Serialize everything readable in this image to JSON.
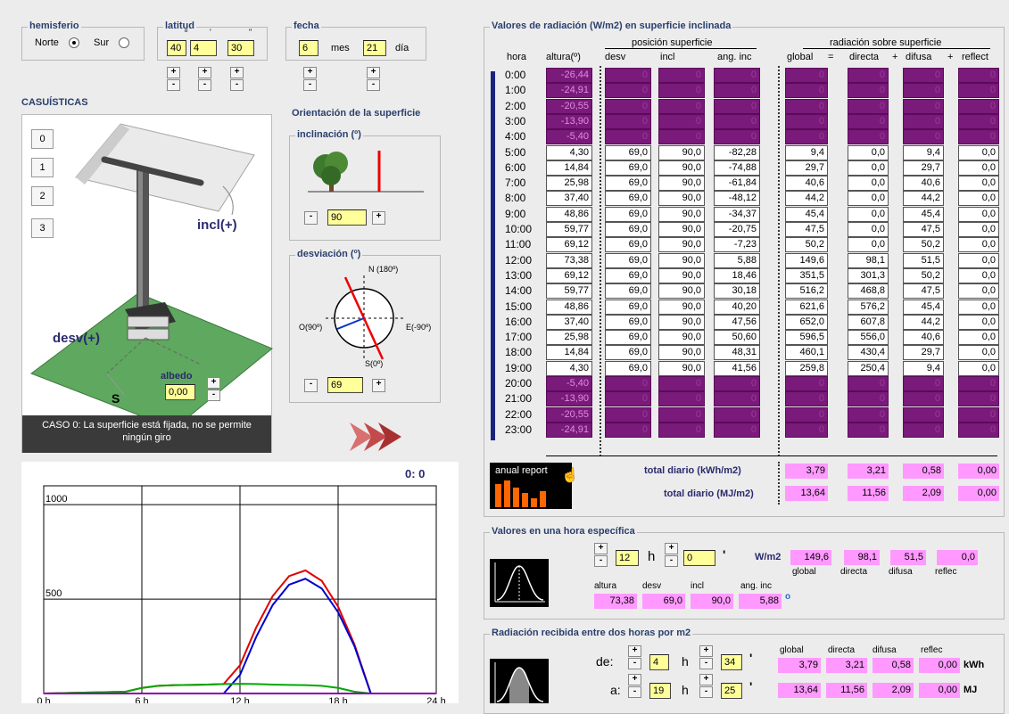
{
  "hemisferio": {
    "title": "hemisferio",
    "norte": "Norte",
    "sur": "Sur",
    "selected": "Norte"
  },
  "latitud": {
    "title": "latitud",
    "deg": "40",
    "min": "4",
    "sec": "30",
    "deg_sym": "º",
    "min_sym": "'",
    "sec_sym": "\""
  },
  "fecha": {
    "title": "fecha",
    "mes_val": "6",
    "mes_lbl": "mes",
    "dia_val": "21",
    "dia_lbl": "día"
  },
  "casuisticas": {
    "title": "CASUÍSTICAS",
    "buttons": [
      "0",
      "1",
      "2",
      "3"
    ],
    "incl_label": "incl(+)",
    "desv_label": "desv(+)",
    "s_label": "S",
    "albedo_label": "albedo",
    "albedo_val": "0,00",
    "caso_text": "CASO 0:  La superficie está fijada, no se permite ningún giro"
  },
  "orientacion": {
    "title": "Orientación de la superficie",
    "inclinacion_title": "inclinación (º)",
    "incl_val": "90",
    "desviacion_title": "desviación (º)",
    "desv_val": "69",
    "n": "N (180º)",
    "s": "S(0º)",
    "o": "O(90º)",
    "e": "E(-90º)"
  },
  "tabla": {
    "title": "Valores de radiación (W/m2) en superficie inclinada",
    "h_hora": "hora",
    "h_altura": "altura(º)",
    "h_pos": "posición superficie",
    "h_desv": "desv",
    "h_incl": "incl",
    "h_anginc": "ang. inc",
    "h_rad": "radiación sobre superficie",
    "h_global": "global",
    "h_eq": "=",
    "h_directa": "directa",
    "h_plus1": "+",
    "h_difusa": "difusa",
    "h_plus2": "+",
    "h_reflect": "reflect",
    "rows": [
      {
        "h": "0:00",
        "a": "-26,44",
        "d": "0",
        "i": "0",
        "g": "0",
        "gl": "0",
        "di": "0",
        "df": "0",
        "rf": "0",
        "p": true
      },
      {
        "h": "1:00",
        "a": "-24,91",
        "d": "0",
        "i": "0",
        "g": "0",
        "gl": "0",
        "di": "0",
        "df": "0",
        "rf": "0",
        "p": true
      },
      {
        "h": "2:00",
        "a": "-20,55",
        "d": "0",
        "i": "0",
        "g": "0",
        "gl": "0",
        "di": "0",
        "df": "0",
        "rf": "0",
        "p": true
      },
      {
        "h": "3:00",
        "a": "-13,90",
        "d": "0",
        "i": "0",
        "g": "0",
        "gl": "0",
        "di": "0",
        "df": "0",
        "rf": "0",
        "p": true
      },
      {
        "h": "4:00",
        "a": "-5,40",
        "d": "0",
        "i": "0",
        "g": "0",
        "gl": "0",
        "di": "0",
        "df": "0",
        "rf": "0",
        "p": true
      },
      {
        "h": "5:00",
        "a": "4,30",
        "d": "69,0",
        "i": "90,0",
        "g": "-82,28",
        "gl": "9,4",
        "di": "0,0",
        "df": "9,4",
        "rf": "0,0",
        "p": false
      },
      {
        "h": "6:00",
        "a": "14,84",
        "d": "69,0",
        "i": "90,0",
        "g": "-74,88",
        "gl": "29,7",
        "di": "0,0",
        "df": "29,7",
        "rf": "0,0",
        "p": false
      },
      {
        "h": "7:00",
        "a": "25,98",
        "d": "69,0",
        "i": "90,0",
        "g": "-61,84",
        "gl": "40,6",
        "di": "0,0",
        "df": "40,6",
        "rf": "0,0",
        "p": false
      },
      {
        "h": "8:00",
        "a": "37,40",
        "d": "69,0",
        "i": "90,0",
        "g": "-48,12",
        "gl": "44,2",
        "di": "0,0",
        "df": "44,2",
        "rf": "0,0",
        "p": false
      },
      {
        "h": "9:00",
        "a": "48,86",
        "d": "69,0",
        "i": "90,0",
        "g": "-34,37",
        "gl": "45,4",
        "di": "0,0",
        "df": "45,4",
        "rf": "0,0",
        "p": false
      },
      {
        "h": "10:00",
        "a": "59,77",
        "d": "69,0",
        "i": "90,0",
        "g": "-20,75",
        "gl": "47,5",
        "di": "0,0",
        "df": "47,5",
        "rf": "0,0",
        "p": false
      },
      {
        "h": "11:00",
        "a": "69,12",
        "d": "69,0",
        "i": "90,0",
        "g": "-7,23",
        "gl": "50,2",
        "di": "0,0",
        "df": "50,2",
        "rf": "0,0",
        "p": false
      },
      {
        "h": "12:00",
        "a": "73,38",
        "d": "69,0",
        "i": "90,0",
        "g": "5,88",
        "gl": "149,6",
        "di": "98,1",
        "df": "51,5",
        "rf": "0,0",
        "p": false
      },
      {
        "h": "13:00",
        "a": "69,12",
        "d": "69,0",
        "i": "90,0",
        "g": "18,46",
        "gl": "351,5",
        "di": "301,3",
        "df": "50,2",
        "rf": "0,0",
        "p": false
      },
      {
        "h": "14:00",
        "a": "59,77",
        "d": "69,0",
        "i": "90,0",
        "g": "30,18",
        "gl": "516,2",
        "di": "468,8",
        "df": "47,5",
        "rf": "0,0",
        "p": false
      },
      {
        "h": "15:00",
        "a": "48,86",
        "d": "69,0",
        "i": "90,0",
        "g": "40,20",
        "gl": "621,6",
        "di": "576,2",
        "df": "45,4",
        "rf": "0,0",
        "p": false
      },
      {
        "h": "16:00",
        "a": "37,40",
        "d": "69,0",
        "i": "90,0",
        "g": "47,56",
        "gl": "652,0",
        "di": "607,8",
        "df": "44,2",
        "rf": "0,0",
        "p": false
      },
      {
        "h": "17:00",
        "a": "25,98",
        "d": "69,0",
        "i": "90,0",
        "g": "50,60",
        "gl": "596,5",
        "di": "556,0",
        "df": "40,6",
        "rf": "0,0",
        "p": false
      },
      {
        "h": "18:00",
        "a": "14,84",
        "d": "69,0",
        "i": "90,0",
        "g": "48,31",
        "gl": "460,1",
        "di": "430,4",
        "df": "29,7",
        "rf": "0,0",
        "p": false
      },
      {
        "h": "19:00",
        "a": "4,30",
        "d": "69,0",
        "i": "90,0",
        "g": "41,56",
        "gl": "259,8",
        "di": "250,4",
        "df": "9,4",
        "rf": "0,0",
        "p": false
      },
      {
        "h": "20:00",
        "a": "-5,40",
        "d": "0",
        "i": "0",
        "g": "0",
        "gl": "0",
        "di": "0",
        "df": "0",
        "rf": "0",
        "p": true
      },
      {
        "h": "21:00",
        "a": "-13,90",
        "d": "0",
        "i": "0",
        "g": "0",
        "gl": "0",
        "di": "0",
        "df": "0",
        "rf": "0",
        "p": true
      },
      {
        "h": "22:00",
        "a": "-20,55",
        "d": "0",
        "i": "0",
        "g": "0",
        "gl": "0",
        "di": "0",
        "df": "0",
        "rf": "0",
        "p": true
      },
      {
        "h": "23:00",
        "a": "-24,91",
        "d": "0",
        "i": "0",
        "g": "0",
        "gl": "0",
        "di": "0",
        "df": "0",
        "rf": "0",
        "p": true
      }
    ],
    "anual_report": "anual report",
    "total_kwh_label": "total diario (kWh/m2)",
    "total_kwh": [
      "3,79",
      "3,21",
      "0,58",
      "0,00"
    ],
    "total_mj_label": "total diario (MJ/m2)",
    "total_mj": [
      "13,64",
      "11,56",
      "2,09",
      "0,00"
    ]
  },
  "hora_especifica": {
    "title": "Valores en una hora específica",
    "h_val": "12",
    "h_lbl": "h",
    "m_val": "0",
    "m_sym": "'",
    "wm2": "W/m2",
    "vals": [
      "149,6",
      "98,1",
      "51,5",
      "0,0"
    ],
    "val_lbls": [
      "global",
      "directa",
      "difusa",
      "reflec"
    ],
    "sub_lbls": [
      "altura",
      "desv",
      "incl",
      "ang. inc"
    ],
    "sub_vals": [
      "73,38",
      "69,0",
      "90,0",
      "5,88"
    ],
    "deg": "o"
  },
  "entre_horas": {
    "title": "Radiación recibida entre dos horas por m2",
    "de": "de:",
    "de_h": "4",
    "de_m": "34",
    "a": "a:",
    "a_h": "19",
    "a_m": "25",
    "h_lbl": "h",
    "m_sym": "'",
    "lbls": [
      "global",
      "directa",
      "difusa",
      "reflec"
    ],
    "kwh": [
      "3,79",
      "3,21",
      "0,58",
      "0,00"
    ],
    "kwh_unit": "kWh",
    "mj": [
      "13,64",
      "11,56",
      "2,09",
      "0,00"
    ],
    "mj_unit": "MJ"
  },
  "chart_data": {
    "type": "line",
    "title": "",
    "time_readout": "0:  0",
    "ylim": [
      0,
      1100
    ],
    "xlim": [
      0,
      24
    ],
    "yticks": [
      "1000",
      "500"
    ],
    "xticks": [
      "0 h",
      "6 h",
      "12 h",
      "18 h",
      "24 h"
    ],
    "series": [
      {
        "color": "#e00000",
        "x": [
          0,
          5,
          6,
          7,
          8,
          9,
          10,
          11,
          12,
          13,
          14,
          15,
          16,
          17,
          18,
          19,
          20,
          24
        ],
        "y": [
          0,
          9.4,
          29.7,
          40.6,
          44.2,
          45.4,
          47.5,
          50.2,
          149.6,
          351.5,
          516.2,
          621.6,
          652.0,
          596.5,
          460.1,
          259.8,
          0,
          0
        ]
      },
      {
        "color": "#0000cc",
        "x": [
          0,
          11,
          12,
          13,
          14,
          15,
          16,
          17,
          18,
          19,
          20,
          24
        ],
        "y": [
          0,
          0,
          98.1,
          301.3,
          468.8,
          576.2,
          607.8,
          556.0,
          430.4,
          250.4,
          0,
          0
        ]
      },
      {
        "color": "#00aa00",
        "x": [
          0,
          5,
          6,
          7,
          8,
          9,
          10,
          11,
          12,
          13,
          14,
          15,
          16,
          17,
          18,
          19,
          20,
          24
        ],
        "y": [
          0,
          9.4,
          29.7,
          40.6,
          44.2,
          45.4,
          47.5,
          50.2,
          51.5,
          50.2,
          47.5,
          45.4,
          44.2,
          40.6,
          29.7,
          9.4,
          0,
          0
        ]
      },
      {
        "color": "#8800aa",
        "x": [
          0,
          24
        ],
        "y": [
          0,
          0
        ]
      }
    ]
  }
}
